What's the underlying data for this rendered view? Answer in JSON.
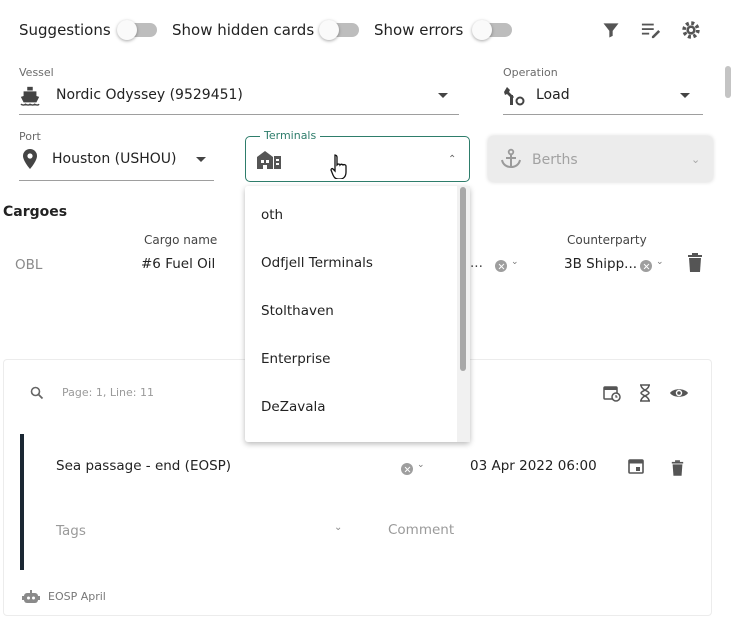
{
  "toolbar": {
    "suggestions_label": "Suggestions",
    "hidden_cards_label": "Show hidden cards",
    "errors_label": "Show errors"
  },
  "vessel": {
    "label": "Vessel",
    "value": "Nordic Odyssey (9529451)"
  },
  "operation": {
    "label": "Operation",
    "value": "Load"
  },
  "port": {
    "label": "Port",
    "value": "Houston (USHOU)"
  },
  "terminals": {
    "label": "Terminals",
    "options": [
      "oth",
      "Odfjell Terminals",
      "Stolthaven",
      "Enterprise",
      "DeZavala"
    ]
  },
  "berths": {
    "placeholder": "Berths"
  },
  "cargoes": {
    "title": "Cargoes",
    "col_cargo_name": "Cargo name",
    "col_counterparty": "Counterparty",
    "row": {
      "type": "OBL",
      "cargo_name": "#6 Fuel Oil",
      "partial": "...",
      "counterparty": "3B Shipp..."
    }
  },
  "event": {
    "page_line": "Page: 1, Line: 11",
    "name": "Sea passage - end (EOSP)",
    "datetime": "03 Apr 2022 06:00",
    "tags_placeholder": "Tags",
    "comment_placeholder": "Comment",
    "source": "EOSP April"
  },
  "colors": {
    "accent": "#2e7d6b",
    "dark_bar": "#1b2733",
    "icon": "#555555"
  }
}
